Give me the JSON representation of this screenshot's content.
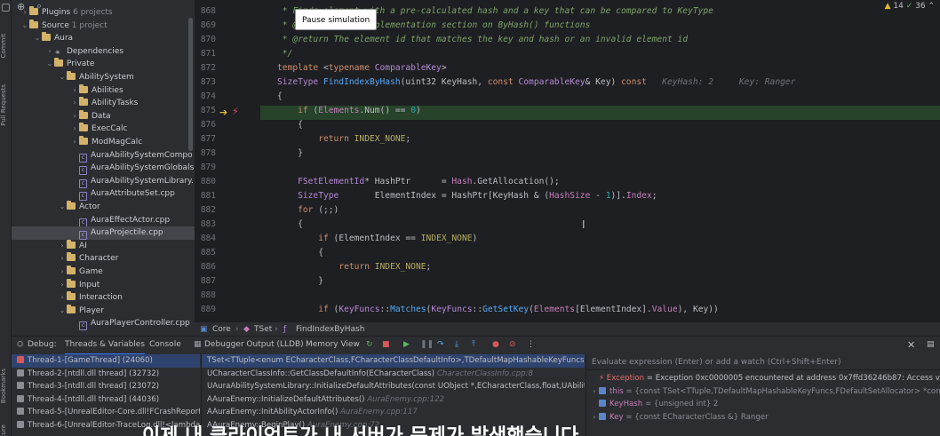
{
  "left_strip": {
    "tabs": [
      "Project",
      "Commit",
      "Pull Requests",
      "Bookmarks",
      "Structure"
    ]
  },
  "project_tree": [
    {
      "label": "Plugins",
      "suffix": "6 projects",
      "indent": 1,
      "type": "folder",
      "arrow": "›"
    },
    {
      "label": "Source",
      "suffix": "1 project",
      "indent": 1,
      "type": "folder",
      "arrow": "⌄"
    },
    {
      "label": "Aura",
      "indent": 2,
      "type": "folder",
      "arrow": "⌄"
    },
    {
      "label": "Dependencies",
      "indent": 3,
      "type": "dep",
      "arrow": "›"
    },
    {
      "label": "Private",
      "indent": 3,
      "type": "folder",
      "arrow": "⌄"
    },
    {
      "label": "AbilitySystem",
      "indent": 4,
      "type": "folder",
      "arrow": "⌄"
    },
    {
      "label": "Abilities",
      "indent": 5,
      "type": "folder",
      "arrow": "›"
    },
    {
      "label": "AbilityTasks",
      "indent": 5,
      "type": "folder",
      "arrow": "›"
    },
    {
      "label": "Data",
      "indent": 5,
      "type": "folder",
      "arrow": "›"
    },
    {
      "label": "ExecCalc",
      "indent": 5,
      "type": "folder",
      "arrow": "›"
    },
    {
      "label": "ModMagCalc",
      "indent": 5,
      "type": "folder",
      "arrow": "›"
    },
    {
      "label": "AuraAbilitySystemCompo",
      "indent": 5,
      "type": "cpp",
      "arrow": ""
    },
    {
      "label": "AuraAbilitySystemGlobals",
      "indent": 5,
      "type": "cpp",
      "arrow": ""
    },
    {
      "label": "AuraAbilitySystemLibrary.",
      "indent": 5,
      "type": "cpp",
      "arrow": ""
    },
    {
      "label": "AuraAttributeSet.cpp",
      "indent": 5,
      "type": "cpp",
      "arrow": ""
    },
    {
      "label": "Actor",
      "indent": 4,
      "type": "folder",
      "arrow": "⌄"
    },
    {
      "label": "AuraEffectActor.cpp",
      "indent": 5,
      "type": "cpp",
      "arrow": ""
    },
    {
      "label": "AuraProjectile.cpp",
      "indent": 5,
      "type": "cpp",
      "arrow": "",
      "selected": true
    },
    {
      "label": "AI",
      "indent": 4,
      "type": "folder",
      "arrow": "›"
    },
    {
      "label": "Character",
      "indent": 4,
      "type": "folder",
      "arrow": "›"
    },
    {
      "label": "Game",
      "indent": 4,
      "type": "folder",
      "arrow": "›"
    },
    {
      "label": "Input",
      "indent": 4,
      "type": "folder",
      "arrow": "›"
    },
    {
      "label": "Interaction",
      "indent": 4,
      "type": "folder",
      "arrow": "›"
    },
    {
      "label": "Player",
      "indent": 4,
      "type": "folder",
      "arrow": "⌄"
    },
    {
      "label": "AuraPlayerController.cpp",
      "indent": 5,
      "type": "cpp",
      "arrow": ""
    }
  ],
  "editor": {
    "tooltip": "Pause simulation",
    "inspections": {
      "warnings": "14",
      "ok": "36"
    },
    "line_numbers": [
      "868",
      "869",
      "870",
      "871",
      "872",
      "873",
      "874",
      "875",
      "876",
      "877",
      "878",
      "879",
      "880",
      "881",
      "882",
      "883",
      "884",
      "885",
      "886",
      "887",
      "888",
      "889"
    ],
    "lines": [
      [
        {
          "t": " * ",
          "c": "cm"
        },
        {
          "t": "Finds element with a pre-calculated hash and a key that can be compared to KeyType",
          "c": "cm"
        }
      ],
      [
        {
          "t": " * ",
          "c": "cm"
        },
        {
          "t": "@see    Class implementation section on ByHash() functions",
          "c": "cm"
        }
      ],
      [
        {
          "t": " * @return ",
          "c": "cm"
        },
        {
          "t": "The element id that matches the key and hash or an invalid element id",
          "c": "cm"
        }
      ],
      [
        {
          "t": " */",
          "c": "cm"
        }
      ],
      [
        {
          "t": "template ",
          "c": "kw"
        },
        {
          "t": "<",
          "c": ""
        },
        {
          "t": "typename ",
          "c": "kw"
        },
        {
          "t": "ComparableKey",
          "c": "ty"
        },
        {
          "t": ">",
          "c": ""
        }
      ],
      [
        {
          "t": "SizeType ",
          "c": "ty"
        },
        {
          "t": "FindIndexByHash",
          "c": "fn"
        },
        {
          "t": "(uint32 ",
          "c": ""
        },
        {
          "t": "KeyHash",
          "c": ""
        },
        {
          "t": ", ",
          "c": ""
        },
        {
          "t": "const ",
          "c": "kw"
        },
        {
          "t": "ComparableKey",
          "c": "ty"
        },
        {
          "t": "& Key) ",
          "c": ""
        },
        {
          "t": "const",
          "c": "kw"
        },
        {
          "t": "   KeyHash: 2     Key: Ranger",
          "c": "hint"
        }
      ],
      [
        {
          "t": "{",
          "c": ""
        }
      ],
      [
        {
          "t": "    ",
          "c": ""
        },
        {
          "t": "if ",
          "c": "kw"
        },
        {
          "t": "(",
          "c": ""
        },
        {
          "t": "Elements",
          "c": "var"
        },
        {
          "t": ".Num() == ",
          "c": ""
        },
        {
          "t": "0",
          "c": "num"
        },
        {
          "t": ")",
          "c": ""
        }
      ],
      [
        {
          "t": "    {",
          "c": ""
        }
      ],
      [
        {
          "t": "        ",
          "c": ""
        },
        {
          "t": "return ",
          "c": "kw"
        },
        {
          "t": "INDEX_NONE",
          "c": "mc"
        },
        {
          "t": ";",
          "c": ""
        }
      ],
      [
        {
          "t": "    }",
          "c": ""
        }
      ],
      [
        {
          "t": "",
          "c": ""
        }
      ],
      [
        {
          "t": "    ",
          "c": ""
        },
        {
          "t": "FSetElementId",
          "c": "ty"
        },
        {
          "t": "* HashPtr      = ",
          "c": ""
        },
        {
          "t": "Hash",
          "c": "var"
        },
        {
          "t": ".GetAllocation();",
          "c": ""
        }
      ],
      [
        {
          "t": "    ",
          "c": ""
        },
        {
          "t": "SizeType",
          "c": "ty"
        },
        {
          "t": "       ElementIndex = HashPtr[KeyHash & (",
          "c": ""
        },
        {
          "t": "HashSize",
          "c": "var"
        },
        {
          "t": " - ",
          "c": ""
        },
        {
          "t": "1",
          "c": "num"
        },
        {
          "t": ")].",
          "c": ""
        },
        {
          "t": "Index",
          "c": "var"
        },
        {
          "t": ";",
          "c": ""
        }
      ],
      [
        {
          "t": "    ",
          "c": ""
        },
        {
          "t": "for ",
          "c": "kw"
        },
        {
          "t": "(;;)",
          "c": ""
        }
      ],
      [
        {
          "t": "    {",
          "c": ""
        }
      ],
      [
        {
          "t": "        ",
          "c": ""
        },
        {
          "t": "if ",
          "c": "kw"
        },
        {
          "t": "(ElementIndex == ",
          "c": ""
        },
        {
          "t": "INDEX_NONE",
          "c": "mc"
        },
        {
          "t": ")",
          "c": ""
        }
      ],
      [
        {
          "t": "        {",
          "c": ""
        }
      ],
      [
        {
          "t": "            ",
          "c": ""
        },
        {
          "t": "return ",
          "c": "kw"
        },
        {
          "t": "INDEX_NONE",
          "c": "mc"
        },
        {
          "t": ";",
          "c": ""
        }
      ],
      [
        {
          "t": "        }",
          "c": ""
        }
      ],
      [
        {
          "t": "",
          "c": ""
        }
      ],
      [
        {
          "t": "        ",
          "c": ""
        },
        {
          "t": "if ",
          "c": "kw"
        },
        {
          "t": "(",
          "c": ""
        },
        {
          "t": "KeyFuncs",
          "c": "ty"
        },
        {
          "t": "::",
          "c": ""
        },
        {
          "t": "Matches",
          "c": "fn"
        },
        {
          "t": "(",
          "c": ""
        },
        {
          "t": "KeyFuncs",
          "c": "ty"
        },
        {
          "t": "::",
          "c": ""
        },
        {
          "t": "GetSetKey",
          "c": "fn"
        },
        {
          "t": "(",
          "c": ""
        },
        {
          "t": "Elements",
          "c": "var"
        },
        {
          "t": "[ElementIndex].",
          "c": ""
        },
        {
          "t": "Value",
          "c": "var"
        },
        {
          "t": "), Key))",
          "c": ""
        }
      ]
    ]
  },
  "breadcrumb": [
    "Core",
    "TSet",
    "FindIndexByHash"
  ],
  "debug": {
    "label": "Debug:",
    "tabs": [
      "Threads & Variables",
      "Console",
      "Debugger Output (LLDB)",
      "Memory View"
    ],
    "threads": [
      {
        "label": "Thread-1-[GameThread] (24060)",
        "selected": true
      },
      {
        "label": "Thread-2-[ntdll.dll thread] (32732)"
      },
      {
        "label": "Thread-3-[ntdll.dll thread] (23072)"
      },
      {
        "label": "Thread-4-[ntdll.dll thread] (44036)"
      },
      {
        "label": "Thread-5-[UnrealEditor-Core.dll!FCrashReportingT"
      },
      {
        "label": "Thread-6-[UnrealEditor-TraceLog.dll!<lambda_42l"
      }
    ],
    "frames": [
      {
        "main": "TSet<TTuple<enum ECharacterClass,FCharacterClassDefaultInfo>,TDefaultMapHashableKeyFuncs<enum EChar",
        "loc": "",
        "selected": true
      },
      {
        "main": "UCharacterClassInfo::GetClassDefaultInfo(ECharacterClass)",
        "loc": "CharacterClassInfo.cpp:8"
      },
      {
        "main": "UAuraAbilitySystemLibrary::InitializeDefaultAttributes(const UObject *,ECharacterClass,float,UAbilitySystemCom",
        "loc": ""
      },
      {
        "main": "AAuraEnemy::InitializeDefaultAttributes()",
        "loc": "AuraEnemy.cpp:122"
      },
      {
        "main": "AAuraEnemy::InitAbilityActorInfo()",
        "loc": "AuraEnemy.cpp:117"
      },
      {
        "main": "AAuraEnemy::BeginPlay()",
        "loc": "AuraEnemy.cpp:72"
      }
    ],
    "eval_placeholder": "Evaluate expression (Enter) or add a watch (Ctrl+Shift+Enter)",
    "variables": [
      {
        "name": "Exception",
        "value": "= Exception 0xc0000005 encountered at address 0x7ffd36246b87: Access violation rea",
        "kind": "exception"
      },
      {
        "name": "this",
        "value": "= {const TSet<TTuple,TDefaultMapHashableKeyFuncs,FDefaultSetAllocator> *const} 0x000",
        "kind": "expand"
      },
      {
        "name": "KeyHash",
        "value": "= {unsigned int} 2",
        "kind": "plain"
      },
      {
        "name": "Key",
        "value": "= {const ECharacterClass &} Ranger",
        "kind": "expand"
      }
    ]
  },
  "subtitle": "이제 내 클라이언트가 내 서버가 문제가 발생했습니다"
}
